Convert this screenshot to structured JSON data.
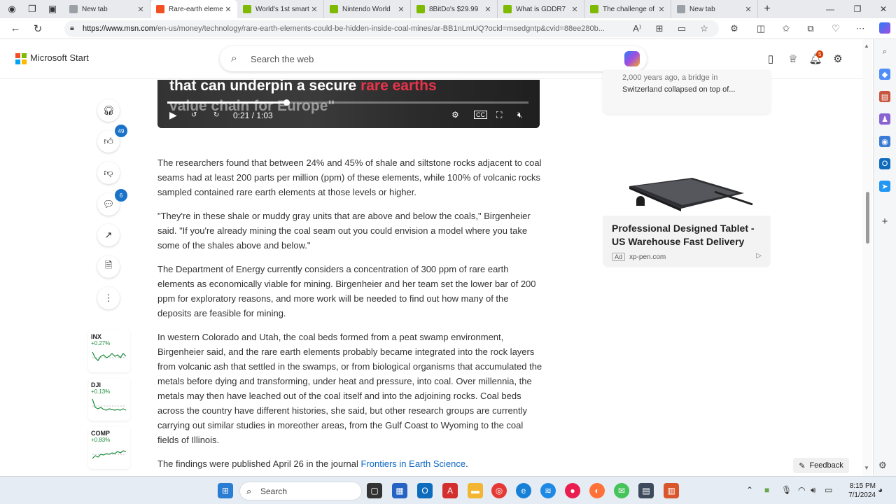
{
  "browser": {
    "tabs": [
      {
        "title": "New tab",
        "color": "#9aa0a6"
      },
      {
        "title": "Rare-earth elements could be hidden",
        "color": "#f25022",
        "active": true
      },
      {
        "title": "World's 1st smart",
        "color": "#7fba00"
      },
      {
        "title": "Nintendo World",
        "color": "#7fba00"
      },
      {
        "title": "8BitDo's $29.99",
        "color": "#7fba00"
      },
      {
        "title": "What is GDDR7",
        "color": "#7fba00"
      },
      {
        "title": "The challenge of",
        "color": "#7fba00"
      },
      {
        "title": "New tab",
        "color": "#9aa0a6"
      }
    ],
    "url_host": "https://www.msn.com",
    "url_rest": "/en-us/money/technology/rare-earth-elements-could-be-hidden-inside-coal-mines/ar-BB1nLmUQ?ocid=msedgntp&cvid=88ee280b..."
  },
  "header": {
    "brand": "Microsoft Start",
    "search_placeholder": "Search the web",
    "notif_count": "5"
  },
  "video": {
    "caption_line1_prefix": "that can underpin a secure ",
    "caption_line1_highlight": "rare earths",
    "caption_line2": "value chain for Europe\"",
    "time": "0:21 / 1:03",
    "progress": 0.33
  },
  "rail": {
    "likes": "49",
    "comments": "6"
  },
  "tickers": [
    {
      "symbol": "INX",
      "change": "+0.27%"
    },
    {
      "symbol": "DJI",
      "change": "+0.13%"
    },
    {
      "symbol": "COMP",
      "change": "+0.83%"
    }
  ],
  "article": {
    "p1": "The researchers found that between 24% and 45% of shale and siltstone rocks adjacent to coal seams had at least 200 parts per million (ppm) of these elements, while 100% of volcanic rocks sampled contained rare earth elements at those levels or higher.",
    "p2": "\"They're in these shale or muddy gray units that are above and below the coals,\" Birgenheier said. \"If you're already mining the coal seam out you could envision a model where you take some of the shales above and below.\"",
    "p3": "The Department of Energy currently considers a concentration of 300 ppm of rare earth elements as economically viable for mining. Birgenheier and her team set the lower bar of 200 ppm for exploratory reasons, and more work will be needed to find out how many of the deposits are feasible for mining.",
    "p4": "In western Colorado and Utah, the coal beds formed from a peat swamp environment, Birgenheier said, and the rare earth elements probably became integrated into the rock layers from volcanic ash that settled in the swamps, or from biological organisms that accumulated the metals before dying and transforming, under heat and pressure, into coal. Over millennia, the metals may then have leached out of the coal itself and into the adjoining rocks. Coal beds across the country have different histories, she said, but other research groups are currently carrying out similar studies in moreother areas, from the Gulf Coast to Wyoming to the coal fields of Illinois.",
    "p5_prefix": "The findings were published April 26 in the journal ",
    "p5_link": "Frontiers in Earth Science",
    "p5_suffix": "."
  },
  "sidecard": {
    "top": "2,000 years ago, a bridge in",
    "text": "Switzerland collapsed on top of..."
  },
  "ad": {
    "title": "Professional Designed Tablet - US Warehouse Fast Delivery",
    "tag": "Ad",
    "source": "xp-pen.com"
  },
  "feedback_label": "Feedback",
  "taskbar": {
    "search": "Search",
    "time": "8:15 PM",
    "date": "7/1/2024"
  }
}
